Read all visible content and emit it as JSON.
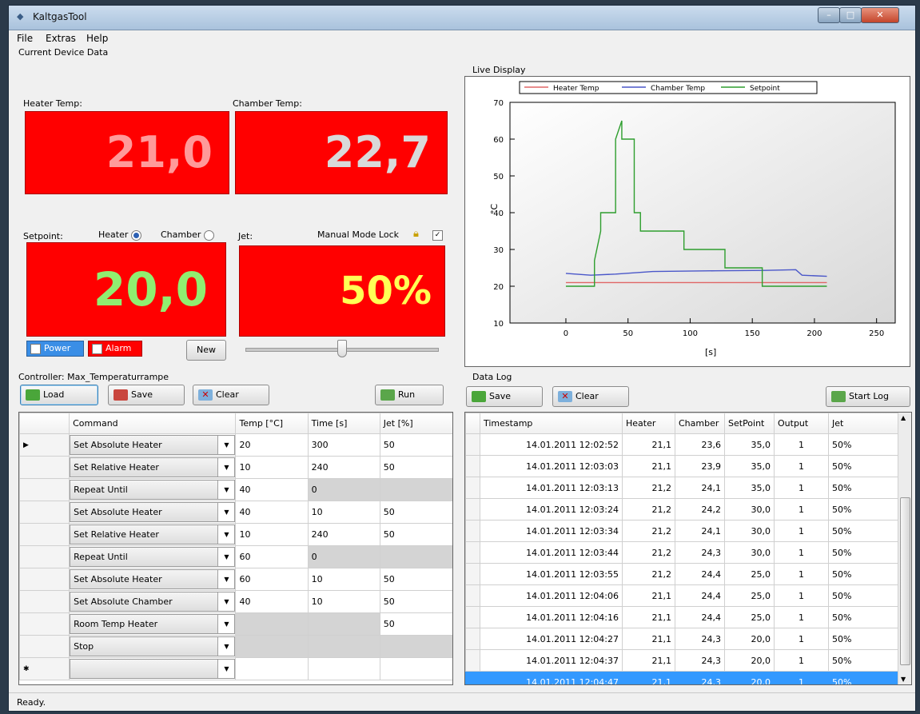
{
  "window": {
    "title": "KaltgasTool"
  },
  "menu": [
    "File",
    "Extras",
    "Help"
  ],
  "current": {
    "section_label": "Current Device Data",
    "heater_label": "Heater Temp:",
    "heater_value": "21,0",
    "chamber_label": "Chamber Temp:",
    "chamber_value": "22,7",
    "setpoint_label": "Setpoint:",
    "heater_radio": "Heater",
    "chamber_radio": "Chamber",
    "setpoint_value": "20,0",
    "jet_label": "Jet:",
    "manual_lock_label": "Manual Mode Lock",
    "jet_value": "50%",
    "power_label": "Power",
    "alarm_label": "Alarm",
    "new_button": "New",
    "jet_slider_percent": 50
  },
  "controller": {
    "label": "Controller: Max_Temperaturrampe",
    "load": "Load",
    "save": "Save",
    "clear": "Clear",
    "run": "Run",
    "columns": [
      "Command",
      "Temp [°C]",
      "Time [s]",
      "Jet [%]"
    ],
    "rows": [
      {
        "cmd": "Set Absolute Heater",
        "temp": "20",
        "time": "300",
        "jet": "50",
        "greyTemp": false,
        "greyTime": false,
        "greyJet": false
      },
      {
        "cmd": "Set Relative Heater",
        "temp": "10",
        "time": "240",
        "jet": "50",
        "greyTemp": false,
        "greyTime": false,
        "greyJet": false
      },
      {
        "cmd": "Repeat Until",
        "temp": "40",
        "time": "0",
        "jet": "",
        "greyTemp": false,
        "greyTime": true,
        "greyJet": true
      },
      {
        "cmd": "Set Absolute Heater",
        "temp": "40",
        "time": "10",
        "jet": "50",
        "greyTemp": false,
        "greyTime": false,
        "greyJet": false
      },
      {
        "cmd": "Set Relative Heater",
        "temp": "10",
        "time": "240",
        "jet": "50",
        "greyTemp": false,
        "greyTime": false,
        "greyJet": false
      },
      {
        "cmd": "Repeat Until",
        "temp": "60",
        "time": "0",
        "jet": "",
        "greyTemp": false,
        "greyTime": true,
        "greyJet": true
      },
      {
        "cmd": "Set Absolute Heater",
        "temp": "60",
        "time": "10",
        "jet": "50",
        "greyTemp": false,
        "greyTime": false,
        "greyJet": false
      },
      {
        "cmd": "Set Absolute Chamber",
        "temp": "40",
        "time": "10",
        "jet": "50",
        "greyTemp": false,
        "greyTime": false,
        "greyJet": false
      },
      {
        "cmd": "Room Temp Heater",
        "temp": "",
        "time": "",
        "jet": "50",
        "greyTemp": true,
        "greyTime": true,
        "greyJet": false
      },
      {
        "cmd": "Stop",
        "temp": "",
        "time": "",
        "jet": "",
        "greyTemp": true,
        "greyTime": true,
        "greyJet": true
      },
      {
        "cmd": "",
        "temp": "",
        "time": "",
        "jet": "",
        "greyTemp": false,
        "greyTime": false,
        "greyJet": false
      }
    ]
  },
  "live": {
    "label": "Live Display",
    "legend": [
      "Heater Temp",
      "Chamber Temp",
      "Setpoint"
    ],
    "ylabel": "°C",
    "xlabel": "[s]"
  },
  "chart_data": {
    "type": "line",
    "xlabel": "[s]",
    "ylabel": "°C",
    "xlim": [
      -45,
      265
    ],
    "ylim": [
      10,
      70
    ],
    "xticks": [
      0,
      50,
      100,
      150,
      200,
      250
    ],
    "yticks": [
      10,
      20,
      30,
      40,
      50,
      60,
      70
    ],
    "legend_position": "top",
    "series": [
      {
        "name": "Heater Temp",
        "color": "#e06666",
        "points": [
          [
            0,
            21
          ],
          [
            210,
            21
          ]
        ]
      },
      {
        "name": "Chamber Temp",
        "color": "#4a57c9",
        "points": [
          [
            0,
            23.5
          ],
          [
            20,
            23
          ],
          [
            40,
            23.3
          ],
          [
            70,
            24
          ],
          [
            120,
            24.2
          ],
          [
            160,
            24.3
          ],
          [
            185,
            24.5
          ],
          [
            190,
            23
          ],
          [
            210,
            22.7
          ]
        ]
      },
      {
        "name": "Setpoint",
        "color": "#2e9e2e",
        "points": [
          [
            0,
            20
          ],
          [
            23,
            20
          ],
          [
            23,
            27
          ],
          [
            28,
            35
          ],
          [
            28,
            40
          ],
          [
            40,
            40
          ],
          [
            40,
            60
          ],
          [
            45,
            65
          ],
          [
            45,
            60
          ],
          [
            55,
            60
          ],
          [
            55,
            40
          ],
          [
            60,
            40
          ],
          [
            60,
            35
          ],
          [
            95,
            35
          ],
          [
            95,
            30
          ],
          [
            120,
            30
          ],
          [
            128,
            30
          ],
          [
            128,
            25
          ],
          [
            158,
            25
          ],
          [
            158,
            20
          ],
          [
            210,
            20
          ]
        ]
      }
    ]
  },
  "log": {
    "label": "Data Log",
    "save": "Save",
    "clear": "Clear",
    "start": "Start Log",
    "columns": [
      "Timestamp",
      "Heater",
      "Chamber",
      "SetPoint",
      "Output",
      "Jet"
    ],
    "rows": [
      [
        "14.01.2011 12:02:52",
        "21,1",
        "23,6",
        "35,0",
        "1",
        "50%"
      ],
      [
        "14.01.2011 12:03:03",
        "21,1",
        "23,9",
        "35,0",
        "1",
        "50%"
      ],
      [
        "14.01.2011 12:03:13",
        "21,2",
        "24,1",
        "35,0",
        "1",
        "50%"
      ],
      [
        "14.01.2011 12:03:24",
        "21,2",
        "24,2",
        "30,0",
        "1",
        "50%"
      ],
      [
        "14.01.2011 12:03:34",
        "21,2",
        "24,1",
        "30,0",
        "1",
        "50%"
      ],
      [
        "14.01.2011 12:03:44",
        "21,2",
        "24,3",
        "30,0",
        "1",
        "50%"
      ],
      [
        "14.01.2011 12:03:55",
        "21,2",
        "24,4",
        "25,0",
        "1",
        "50%"
      ],
      [
        "14.01.2011 12:04:06",
        "21,1",
        "24,4",
        "25,0",
        "1",
        "50%"
      ],
      [
        "14.01.2011 12:04:16",
        "21,1",
        "24,4",
        "25,0",
        "1",
        "50%"
      ],
      [
        "14.01.2011 12:04:27",
        "21,1",
        "24,3",
        "20,0",
        "1",
        "50%"
      ],
      [
        "14.01.2011 12:04:37",
        "21,1",
        "24,3",
        "20,0",
        "1",
        "50%"
      ],
      [
        "14.01.2011 12:04:47",
        "21,1",
        "24,3",
        "20,0",
        "1",
        "50%"
      ]
    ],
    "selected_row": 11
  },
  "status": "Ready."
}
